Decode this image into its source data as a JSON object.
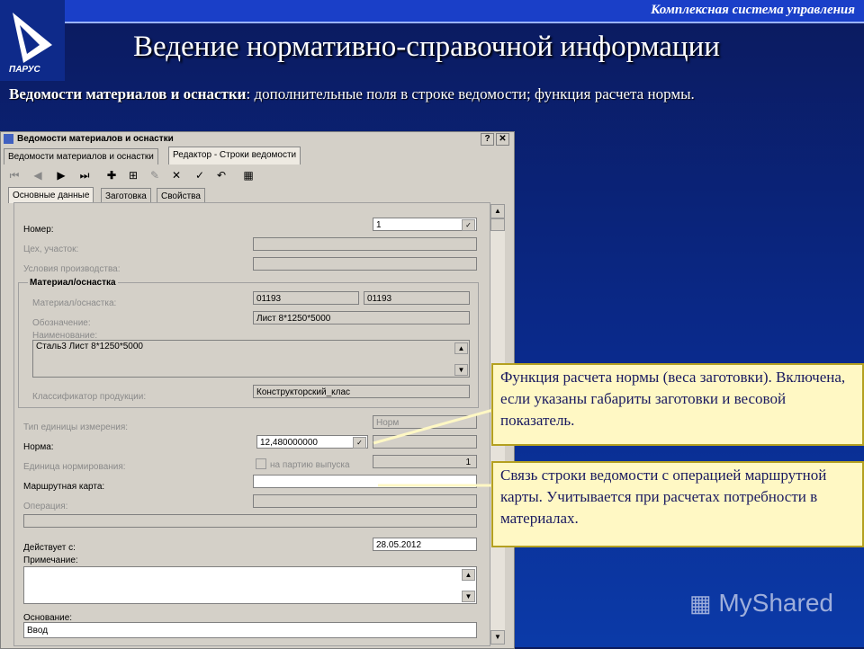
{
  "header": {
    "system_name": "Комплексная система управления",
    "title": "Ведение нормативно-справочной информации",
    "subtitle_bold": "Ведомости материалов и оснастки",
    "subtitle_rest": ": дополнительные поля в строке ведомости; функция расчета нормы."
  },
  "window": {
    "title": "Ведомости материалов и оснастки",
    "help_button": "?",
    "close_button": "✕",
    "outer_tabs": [
      "Ведомости материалов и оснастки",
      "Редактор - Строки ведомости"
    ],
    "inner_tabs": [
      "Основные данные",
      "Заготовка",
      "Свойства"
    ]
  },
  "form": {
    "number_label": "Номер:",
    "number_value": "1",
    "shop_label": "Цех, участок:",
    "conditions_label": "Условия производства:",
    "group_label": "Материал/оснастка",
    "material_label": "Материал/оснастка:",
    "material_code1": "01193",
    "material_code2": "01193",
    "designation_label": "Обозначение:",
    "designation_value": "Лист  8*1250*5000",
    "name_label": "Наименование:",
    "name_value": "Сталь3 Лист  8*1250*5000",
    "classifier_label": "Классификатор продукции:",
    "classifier_value": "Конструкторский_клас",
    "unit_type_label": "Тип единицы измерения:",
    "unit_type_value": "Норм",
    "norm_label": "Норма:",
    "norm_value": "12,480000000",
    "norm_unit_value": "~",
    "norm_unit_label": "Единица нормирования:",
    "per_batch_label": "на партию выпуска",
    "per_batch_value": "1",
    "route_label": "Маршрутная карта:",
    "operation_label": "Операция:",
    "valid_from_label": "Действует с:",
    "valid_from_value": "28.05.2012",
    "note_label": "Примечание:",
    "basis_label": "Основание:",
    "basis_value": "Ввод"
  },
  "callouts": {
    "norm_calc": "Функция расчета нормы (веса заготовки). Включена, если указаны габариты заготовки и весовой показатель.",
    "route_link": "Связь строки ведомости с операцией маршрутной карты. Учитывается при расчетах потребности в материалах."
  },
  "watermark": "MyShared"
}
